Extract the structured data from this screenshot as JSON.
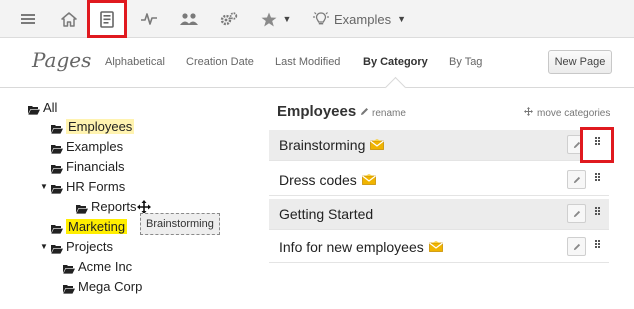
{
  "toolbar": {
    "items": [
      {
        "name": "menu-icon"
      },
      {
        "name": "home-icon"
      },
      {
        "name": "pages-icon",
        "active": true
      },
      {
        "name": "activity-icon"
      },
      {
        "name": "users-icon"
      },
      {
        "name": "settings-icon"
      },
      {
        "name": "favorites-icon"
      },
      {
        "name": "lightbulb-icon"
      }
    ],
    "examples_label": "Examples",
    "highlight_color": "#e0191f"
  },
  "header": {
    "title": "Pages",
    "tabs": [
      {
        "label": "Alphabetical",
        "active": false
      },
      {
        "label": "Creation Date",
        "active": false
      },
      {
        "label": "Last Modified",
        "active": false
      },
      {
        "label": "By Category",
        "active": true
      },
      {
        "label": "By Tag",
        "active": false
      }
    ],
    "new_page_label": "New Page"
  },
  "tree": {
    "root": "All",
    "items": [
      {
        "label": "Employees",
        "highlight": "light"
      },
      {
        "label": "Examples"
      },
      {
        "label": "Financials"
      },
      {
        "label": "HR Forms",
        "expanded": true
      },
      {
        "label": "Reports"
      },
      {
        "label": "Marketing",
        "highlight": "strong"
      },
      {
        "label": "Projects",
        "expanded": true
      },
      {
        "label": "Acme Inc"
      },
      {
        "label": "Mega Corp"
      }
    ],
    "drag_ghost_label": "Brainstorming"
  },
  "panel": {
    "category_title": "Employees",
    "rename_label": "rename",
    "move_categories_label": "move categories",
    "pages": [
      {
        "label": "Brainstorming",
        "mail": true
      },
      {
        "label": "Dress codes",
        "mail": true
      },
      {
        "label": "Getting Started",
        "mail": false
      },
      {
        "label": "Info for new employees",
        "mail": true
      }
    ]
  }
}
